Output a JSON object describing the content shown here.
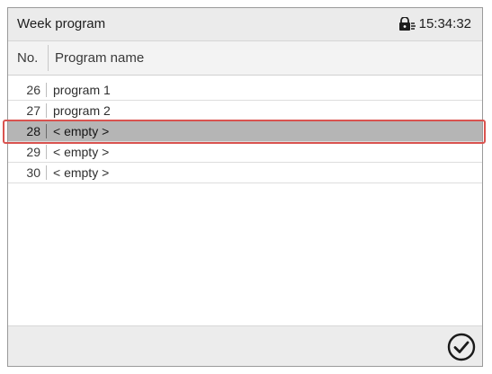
{
  "header": {
    "title": "Week program",
    "lock_icon": "lock-icon",
    "time": "15:34:32"
  },
  "columns": {
    "no": "No.",
    "name": "Program name"
  },
  "rows": [
    {
      "no": "26",
      "name": "program 1"
    },
    {
      "no": "27",
      "name": "program 2"
    },
    {
      "no": "28",
      "name": "< empty >",
      "selected": true
    },
    {
      "no": "29",
      "name": "< empty >"
    },
    {
      "no": "30",
      "name": "< empty >"
    }
  ],
  "footer": {
    "confirm_icon": "checkmark-circle-icon"
  },
  "colors": {
    "selected_row": "#b5b5b5",
    "highlight": "#d9534f"
  }
}
